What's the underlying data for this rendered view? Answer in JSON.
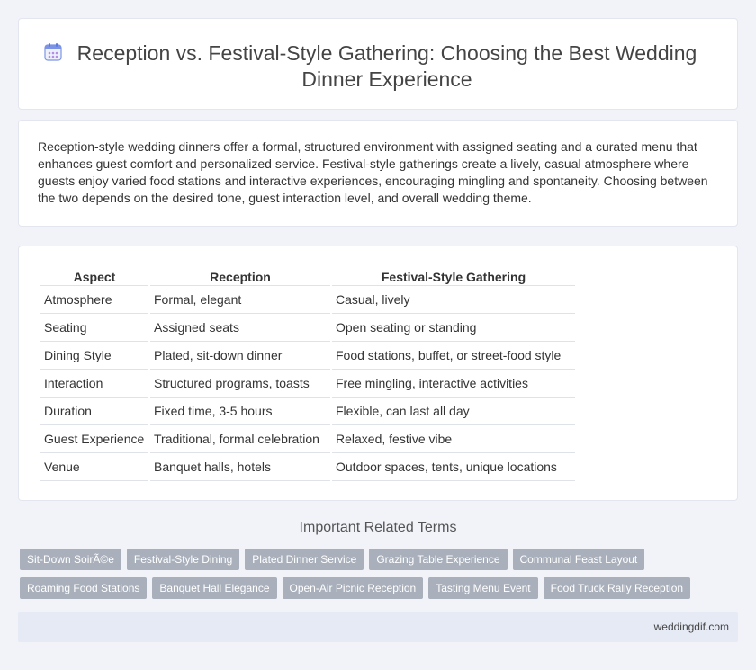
{
  "header": {
    "icon": "calendar-icon",
    "title": "Reception vs. Festival-Style Gathering: Choosing the Best Wedding Dinner Experience"
  },
  "intro": {
    "text": "Reception-style wedding dinners offer a formal, structured environment with assigned seating and a curated menu that enhances guest comfort and personalized service. Festival-style gatherings create a lively, casual atmosphere where guests enjoy varied food stations and interactive experiences, encouraging mingling and spontaneity. Choosing between the two depends on the desired tone, guest interaction level, and overall wedding theme."
  },
  "table": {
    "headers": [
      "Aspect",
      "Reception",
      "Festival-Style Gathering"
    ],
    "rows": [
      [
        "Atmosphere",
        "Formal, elegant",
        "Casual, lively"
      ],
      [
        "Seating",
        "Assigned seats",
        "Open seating or standing"
      ],
      [
        "Dining Style",
        "Plated, sit-down dinner",
        "Food stations, buffet, or street-food style"
      ],
      [
        "Interaction",
        "Structured programs, toasts",
        "Free mingling, interactive activities"
      ],
      [
        "Duration",
        "Fixed time, 3-5 hours",
        "Flexible, can last all day"
      ],
      [
        "Guest Experience",
        "Traditional, formal celebration",
        "Relaxed, festive vibe"
      ],
      [
        "Venue",
        "Banquet halls, hotels",
        "Outdoor spaces, tents, unique locations"
      ]
    ]
  },
  "related": {
    "heading": "Important Related Terms",
    "rows": [
      [
        "Sit-Down SoirÃ©e",
        "Festival-Style Dining",
        "Plated Dinner Service",
        "Grazing Table Experience",
        "Communal Feast Layout"
      ],
      [
        "Roaming Food Stations",
        "Banquet Hall Elegance",
        "Open-Air Picnic Reception",
        "Tasting Menu Event",
        "Food Truck Rally Reception"
      ]
    ]
  },
  "footer": {
    "site": "weddingdif.com"
  },
  "colors": {
    "background": "#f1f3f8",
    "card": "#ffffff",
    "tag": "#a9b0bb",
    "footer": "#e6eaf4",
    "icon_blue": "#5a7be0",
    "icon_purple": "#b48de6"
  }
}
